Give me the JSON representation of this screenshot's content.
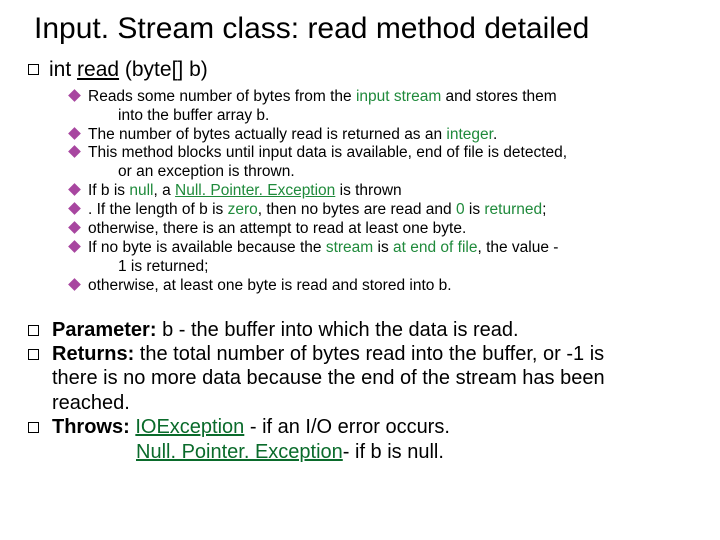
{
  "title": "Input. Stream class: read method detailed",
  "signature": {
    "ret": "int ",
    "name": "read",
    "params": " (byte[] b)"
  },
  "d": {
    "l1a": "Reads some number of bytes from the ",
    "l1b": "input stream",
    "l1c": " and stores them",
    "l1d": "into the buffer array b.",
    "l2a": "The number of bytes actually read is returned as an ",
    "l2b": "integer",
    "l2c": ".",
    "l3a": "This method blocks until input data is available, end of file is detected,",
    "l3b": "or an exception is thrown.",
    "l4a": " If b is ",
    "l4b": "null",
    "l4c": ", a ",
    "l4d": "Null. Pointer. Exception",
    "l4e": " is thrown",
    "l5a": ". If the length of b is ",
    "l5b": "zero",
    "l5c": ", then no bytes are read and ",
    "l5d": "0",
    "l5e": " is ",
    "l5f": "returned",
    "l5g": ";",
    "l6": "otherwise, there is an attempt to read at least one byte.",
    "l7a": " If no byte is available because the ",
    "l7b": "stream",
    "l7c": " is ",
    "l7d": "at end of file",
    "l7e": ", the value -",
    "l7f": "1 is returned;",
    "l8": "otherwise, at least one byte is read and stored into b."
  },
  "p": {
    "param_l": "Parameter:",
    "param_v": " b - the buffer into which the data is read.",
    "ret_l": "Returns:",
    "ret_v1": " the total number of bytes read into the buffer, or -1 is",
    "ret_v2": "there is no more data because the end of the stream has been",
    "ret_v3": "reached.",
    "thr_l": "Throws:",
    "thr_sp": " ",
    "thr_io": "IOException",
    "thr_io_t": "  - if an I/O error occurs.",
    "thr_npe": "Null. Pointer. Exception",
    "thr_npe_t": "- if b is null."
  }
}
